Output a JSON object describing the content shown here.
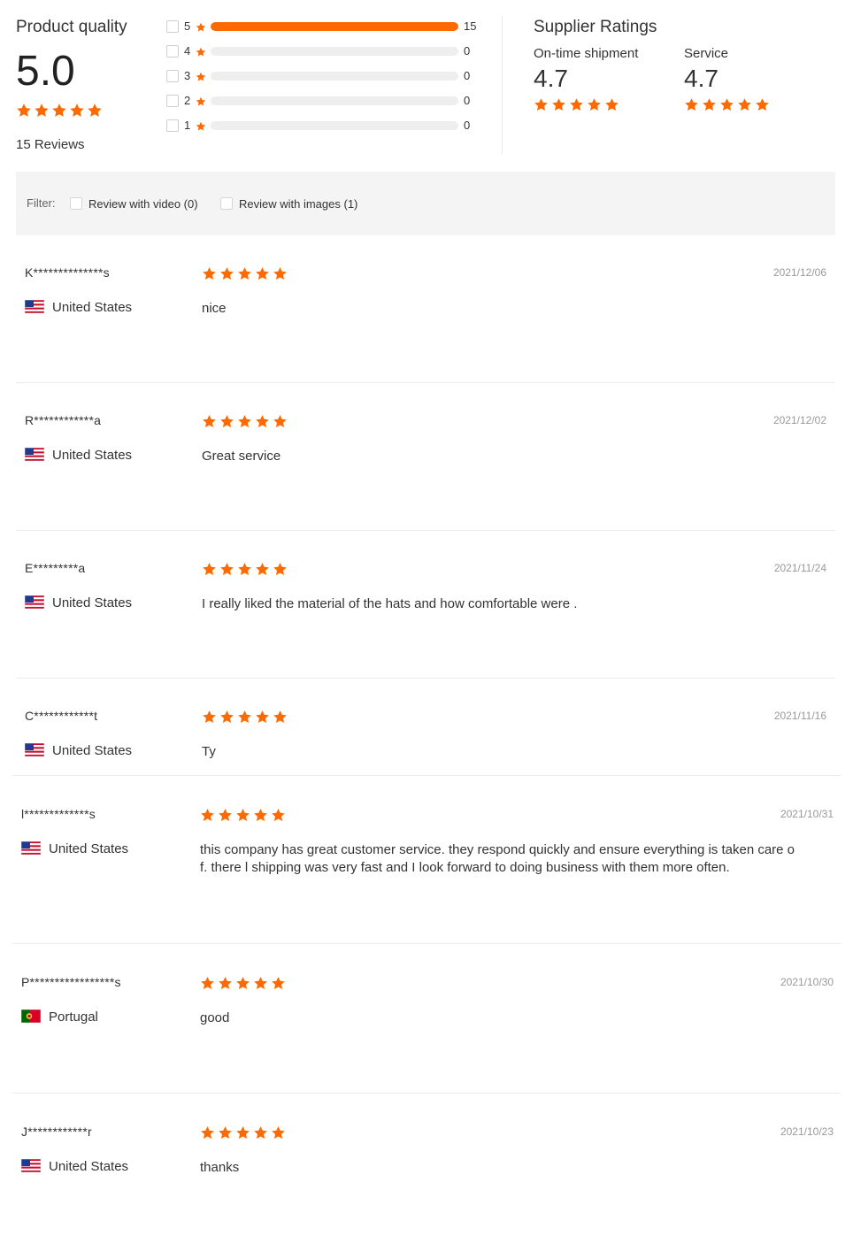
{
  "product_quality": {
    "title": "Product quality",
    "score": "5.0",
    "stars": 5,
    "reviews_count": "15 Reviews",
    "distribution": [
      {
        "stars": "5",
        "count": "15",
        "fraction": 1.0
      },
      {
        "stars": "4",
        "count": "0",
        "fraction": 0
      },
      {
        "stars": "3",
        "count": "0",
        "fraction": 0
      },
      {
        "stars": "2",
        "count": "0",
        "fraction": 0
      },
      {
        "stars": "1",
        "count": "0",
        "fraction": 0
      }
    ]
  },
  "supplier_ratings": {
    "title": "Supplier Ratings",
    "shipment_label": "On-time shipment",
    "shipment_score": "4.7",
    "service_label": "Service",
    "service_score": "4.7"
  },
  "filter": {
    "label": "Filter:",
    "video_label": "Review with video (0)",
    "images_label": "Review with images (1)"
  },
  "colors": {
    "accent": "#ff6a00",
    "bar_track": "#eeeeee",
    "filter_bg": "#f4f4f4"
  },
  "reviews": [
    {
      "name": "K**************s",
      "country": "United States",
      "flag": "us-flag-icon",
      "date": "2021/12/06",
      "rating": 5,
      "text": "nice"
    },
    {
      "name": "R************a",
      "country": "United States",
      "flag": "us-flag-icon",
      "date": "2021/12/02",
      "rating": 5,
      "text": "Great service"
    },
    {
      "name": "E*********a",
      "country": "United States",
      "flag": "us-flag-icon",
      "date": "2021/11/24",
      "rating": 5,
      "text": "I really liked the material of the hats and how comfortable were ."
    },
    {
      "name": "C************t",
      "country": "United States",
      "flag": "us-flag-icon",
      "date": "2021/11/16",
      "rating": 5,
      "text": "Ty"
    },
    {
      "name": "l*************s",
      "country": "United States",
      "flag": "us-flag-icon",
      "date": "2021/10/31",
      "rating": 5,
      "text_line1": "this company has great customer service. they respond quickly and ensure everything is taken care o",
      "text_line2": "f. there l shipping was very fast and I look forward to doing business with them more often."
    },
    {
      "name": "P*****************s",
      "country": "Portugal",
      "flag": "pt-flag-icon",
      "date": "2021/10/30",
      "rating": 5,
      "text": "good"
    },
    {
      "name": "J************r",
      "country": "United States",
      "flag": "us-flag-icon",
      "date": "2021/10/23",
      "rating": 5,
      "text": "thanks"
    }
  ]
}
